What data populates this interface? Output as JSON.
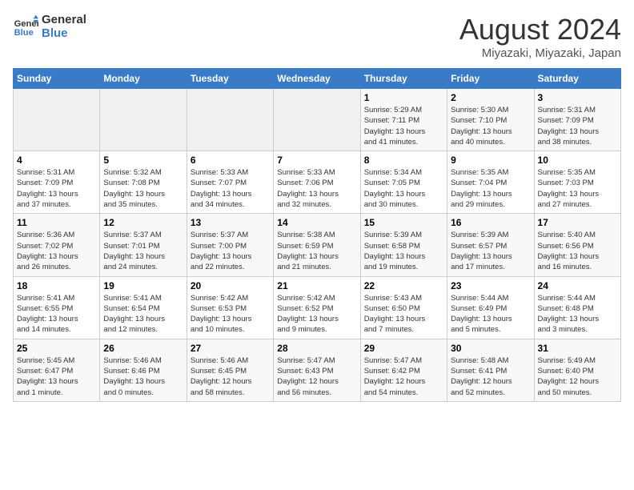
{
  "header": {
    "logo_line1": "General",
    "logo_line2": "Blue",
    "title": "August 2024",
    "subtitle": "Miyazaki, Miyazaki, Japan"
  },
  "days_of_week": [
    "Sunday",
    "Monday",
    "Tuesday",
    "Wednesday",
    "Thursday",
    "Friday",
    "Saturday"
  ],
  "weeks": [
    [
      {
        "day": "",
        "info": ""
      },
      {
        "day": "",
        "info": ""
      },
      {
        "day": "",
        "info": ""
      },
      {
        "day": "",
        "info": ""
      },
      {
        "day": "1",
        "info": "Sunrise: 5:29 AM\nSunset: 7:11 PM\nDaylight: 13 hours\nand 41 minutes."
      },
      {
        "day": "2",
        "info": "Sunrise: 5:30 AM\nSunset: 7:10 PM\nDaylight: 13 hours\nand 40 minutes."
      },
      {
        "day": "3",
        "info": "Sunrise: 5:31 AM\nSunset: 7:09 PM\nDaylight: 13 hours\nand 38 minutes."
      }
    ],
    [
      {
        "day": "4",
        "info": "Sunrise: 5:31 AM\nSunset: 7:09 PM\nDaylight: 13 hours\nand 37 minutes."
      },
      {
        "day": "5",
        "info": "Sunrise: 5:32 AM\nSunset: 7:08 PM\nDaylight: 13 hours\nand 35 minutes."
      },
      {
        "day": "6",
        "info": "Sunrise: 5:33 AM\nSunset: 7:07 PM\nDaylight: 13 hours\nand 34 minutes."
      },
      {
        "day": "7",
        "info": "Sunrise: 5:33 AM\nSunset: 7:06 PM\nDaylight: 13 hours\nand 32 minutes."
      },
      {
        "day": "8",
        "info": "Sunrise: 5:34 AM\nSunset: 7:05 PM\nDaylight: 13 hours\nand 30 minutes."
      },
      {
        "day": "9",
        "info": "Sunrise: 5:35 AM\nSunset: 7:04 PM\nDaylight: 13 hours\nand 29 minutes."
      },
      {
        "day": "10",
        "info": "Sunrise: 5:35 AM\nSunset: 7:03 PM\nDaylight: 13 hours\nand 27 minutes."
      }
    ],
    [
      {
        "day": "11",
        "info": "Sunrise: 5:36 AM\nSunset: 7:02 PM\nDaylight: 13 hours\nand 26 minutes."
      },
      {
        "day": "12",
        "info": "Sunrise: 5:37 AM\nSunset: 7:01 PM\nDaylight: 13 hours\nand 24 minutes."
      },
      {
        "day": "13",
        "info": "Sunrise: 5:37 AM\nSunset: 7:00 PM\nDaylight: 13 hours\nand 22 minutes."
      },
      {
        "day": "14",
        "info": "Sunrise: 5:38 AM\nSunset: 6:59 PM\nDaylight: 13 hours\nand 21 minutes."
      },
      {
        "day": "15",
        "info": "Sunrise: 5:39 AM\nSunset: 6:58 PM\nDaylight: 13 hours\nand 19 minutes."
      },
      {
        "day": "16",
        "info": "Sunrise: 5:39 AM\nSunset: 6:57 PM\nDaylight: 13 hours\nand 17 minutes."
      },
      {
        "day": "17",
        "info": "Sunrise: 5:40 AM\nSunset: 6:56 PM\nDaylight: 13 hours\nand 16 minutes."
      }
    ],
    [
      {
        "day": "18",
        "info": "Sunrise: 5:41 AM\nSunset: 6:55 PM\nDaylight: 13 hours\nand 14 minutes."
      },
      {
        "day": "19",
        "info": "Sunrise: 5:41 AM\nSunset: 6:54 PM\nDaylight: 13 hours\nand 12 minutes."
      },
      {
        "day": "20",
        "info": "Sunrise: 5:42 AM\nSunset: 6:53 PM\nDaylight: 13 hours\nand 10 minutes."
      },
      {
        "day": "21",
        "info": "Sunrise: 5:42 AM\nSunset: 6:52 PM\nDaylight: 13 hours\nand 9 minutes."
      },
      {
        "day": "22",
        "info": "Sunrise: 5:43 AM\nSunset: 6:50 PM\nDaylight: 13 hours\nand 7 minutes."
      },
      {
        "day": "23",
        "info": "Sunrise: 5:44 AM\nSunset: 6:49 PM\nDaylight: 13 hours\nand 5 minutes."
      },
      {
        "day": "24",
        "info": "Sunrise: 5:44 AM\nSunset: 6:48 PM\nDaylight: 13 hours\nand 3 minutes."
      }
    ],
    [
      {
        "day": "25",
        "info": "Sunrise: 5:45 AM\nSunset: 6:47 PM\nDaylight: 13 hours\nand 1 minute."
      },
      {
        "day": "26",
        "info": "Sunrise: 5:46 AM\nSunset: 6:46 PM\nDaylight: 13 hours\nand 0 minutes."
      },
      {
        "day": "27",
        "info": "Sunrise: 5:46 AM\nSunset: 6:45 PM\nDaylight: 12 hours\nand 58 minutes."
      },
      {
        "day": "28",
        "info": "Sunrise: 5:47 AM\nSunset: 6:43 PM\nDaylight: 12 hours\nand 56 minutes."
      },
      {
        "day": "29",
        "info": "Sunrise: 5:47 AM\nSunset: 6:42 PM\nDaylight: 12 hours\nand 54 minutes."
      },
      {
        "day": "30",
        "info": "Sunrise: 5:48 AM\nSunset: 6:41 PM\nDaylight: 12 hours\nand 52 minutes."
      },
      {
        "day": "31",
        "info": "Sunrise: 5:49 AM\nSunset: 6:40 PM\nDaylight: 12 hours\nand 50 minutes."
      }
    ]
  ]
}
